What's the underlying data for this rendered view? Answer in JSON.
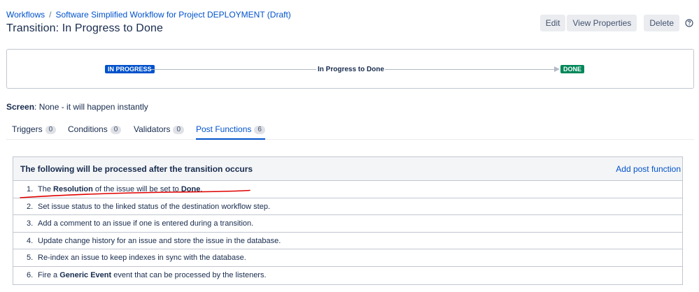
{
  "breadcrumb": {
    "root": "Workflows",
    "separator": "/",
    "current": "Software Simplified Workflow for Project DEPLOYMENT (Draft)"
  },
  "page_title": "Transition: In Progress to Done",
  "actions": {
    "edit": "Edit",
    "view_properties": "View Properties",
    "delete": "Delete"
  },
  "diagram": {
    "from_status": "IN PROGRESS",
    "transition": "In Progress to Done",
    "to_status": "DONE",
    "from_color": "#0052cc",
    "to_color": "#00875a"
  },
  "screen": {
    "label": "Screen",
    "value": ": None - it will happen instantly"
  },
  "tabs": [
    {
      "label": "Triggers",
      "count": "0"
    },
    {
      "label": "Conditions",
      "count": "0"
    },
    {
      "label": "Validators",
      "count": "0"
    },
    {
      "label": "Post Functions",
      "count": "6"
    }
  ],
  "post_functions": {
    "heading": "The following will be processed after the transition occurs",
    "add_link": "Add post function",
    "items": [
      {
        "num": "1.",
        "p1": "The ",
        "b1": "Resolution",
        "p2": " of the issue will be set to ",
        "b2": "Done",
        "p3": "."
      },
      {
        "num": "2.",
        "p1": "Set issue status to the linked status of the destination workflow step."
      },
      {
        "num": "3.",
        "p1": "Add a comment to an issue if one is entered during a transition."
      },
      {
        "num": "4.",
        "p1": "Update change history for an issue and store the issue in the database."
      },
      {
        "num": "5.",
        "p1": "Re-index an issue to keep indexes in sync with the database."
      },
      {
        "num": "6.",
        "p1": "Fire a ",
        "b1": "Generic Event",
        "p2": " event that can be processed by the listeners."
      }
    ]
  },
  "annotation_color": "#e00000"
}
